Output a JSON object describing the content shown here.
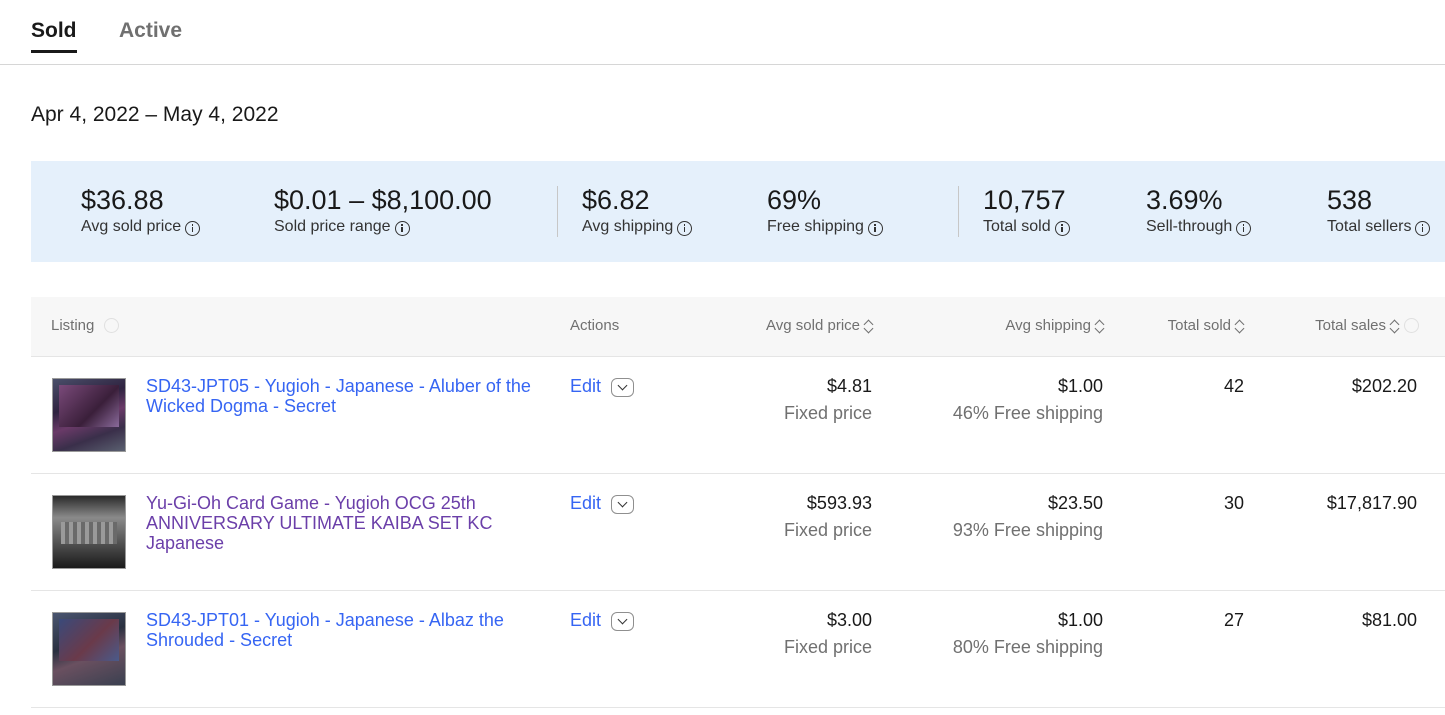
{
  "tabs": {
    "sold": "Sold",
    "active": "Active"
  },
  "date_range": "Apr 4, 2022 – May 4, 2022",
  "stats": {
    "avg_sold_price": {
      "value": "$36.88",
      "label": "Avg sold price"
    },
    "sold_price_range": {
      "value": "$0.01 – $8,100.00",
      "label": "Sold price range"
    },
    "avg_shipping": {
      "value": "$6.82",
      "label": "Avg shipping"
    },
    "free_shipping": {
      "value": "69%",
      "label": "Free shipping"
    },
    "total_sold": {
      "value": "10,757",
      "label": "Total sold"
    },
    "sell_through": {
      "value": "3.69%",
      "label": "Sell-through"
    },
    "total_sellers": {
      "value": "538",
      "label": "Total sellers"
    }
  },
  "table": {
    "headers": {
      "listing": "Listing",
      "actions": "Actions",
      "avg_sold_price": "Avg sold price",
      "avg_shipping": "Avg shipping",
      "total_sold": "Total sold",
      "total_sales": "Total sales"
    },
    "rows": [
      {
        "title": "SD43-JPT05 - Yugioh - Japanese - Aluber of the Wicked Dogma - Secret",
        "action": "Edit",
        "price": "$4.81",
        "price_type": "Fixed price",
        "shipping": "$1.00",
        "free_shipping": "46% Free shipping",
        "total_sold": "42",
        "total_sales": "$202.20",
        "visited": false
      },
      {
        "title": "Yu-Gi-Oh Card Game - Yugioh OCG 25th ANNIVERSARY ULTIMATE KAIBA SET KC Japanese",
        "action": "Edit",
        "price": "$593.93",
        "price_type": "Fixed price",
        "shipping": "$23.50",
        "free_shipping": "93% Free shipping",
        "total_sold": "30",
        "total_sales": "$17,817.90",
        "visited": true
      },
      {
        "title": "SD43-JPT01 - Yugioh - Japanese - Albaz the Shrouded - Secret",
        "action": "Edit",
        "price": "$3.00",
        "price_type": "Fixed price",
        "shipping": "$1.00",
        "free_shipping": "80% Free shipping",
        "total_sold": "27",
        "total_sales": "$81.00",
        "visited": false
      }
    ]
  },
  "colors": {
    "link": "#3665f3",
    "visited_link": "#6b3fa9",
    "stats_bg": "#e5f0fb",
    "header_bg": "#f7f7f7"
  }
}
